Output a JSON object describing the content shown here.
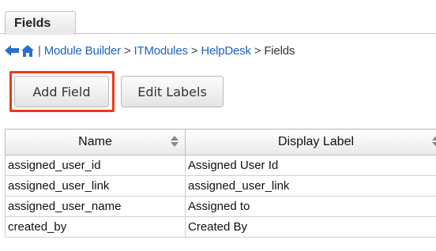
{
  "tab": {
    "label": "Fields"
  },
  "breadcrumb": {
    "back_icon": "back-arrow-icon",
    "home_icon": "home-icon",
    "items": [
      "Module Builder",
      "ITModules",
      "HelpDesk"
    ],
    "separator": ">",
    "current": "Fields"
  },
  "toolbar": {
    "add_field_label": "Add Field",
    "edit_labels_label": "Edit Labels",
    "highlight_color": "#e8391f"
  },
  "table": {
    "columns": [
      "Name",
      "Display Label"
    ],
    "rows": [
      [
        "assigned_user_id",
        "Assigned User Id"
      ],
      [
        "assigned_user_link",
        "assigned_user_link"
      ],
      [
        "assigned_user_name",
        "Assigned to"
      ],
      [
        "created_by",
        "Created By"
      ]
    ]
  },
  "colors": {
    "link": "#1a63c5"
  }
}
